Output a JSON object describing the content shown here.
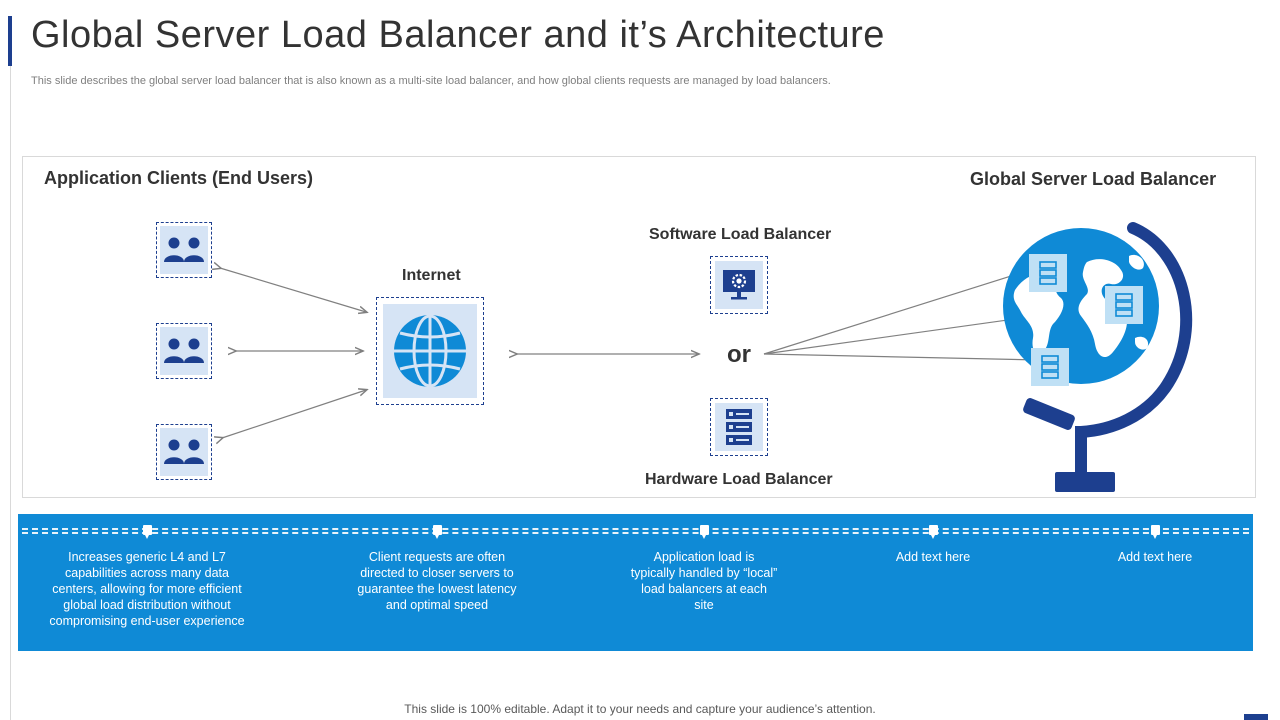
{
  "slide": {
    "title": "Global Server Load Balancer and it’s Architecture",
    "subtitle": "This slide describes the global server load balancer that is also known as a multi-site load balancer, and how global clients requests are managed by load balancers.",
    "footer": "This slide is 100% editable. Adapt it to your needs and capture your audience’s attention."
  },
  "diagram": {
    "clients_heading": "Application Clients (End Users)",
    "gslb_heading": "Global Server Load Balancer",
    "internet_label": "Internet",
    "software_lb_label": "Software Load Balancer",
    "or_label": "or",
    "hardware_lb_label": "Hardware Load Balancer",
    "icons": [
      "users-icon",
      "users-icon",
      "users-icon",
      "globe-icon",
      "monitor-gear-icon",
      "server-rack-icon",
      "world-globe-icon",
      "server-icon"
    ]
  },
  "band": {
    "items": [
      "Increases generic L4 and L7 capabilities across many data centers, allowing for more efficient global load distribution without compromising end-user experience",
      "Client requests are often directed to closer servers to guarantee the lowest latency and optimal speed",
      "Application load is typically handled by “local” load balancers at each site",
      "Add text here",
      "Add text here"
    ]
  },
  "colors": {
    "navy": "#1d3f8f",
    "blue": "#0f8ad6",
    "light_blue": "#d6e4f5"
  }
}
